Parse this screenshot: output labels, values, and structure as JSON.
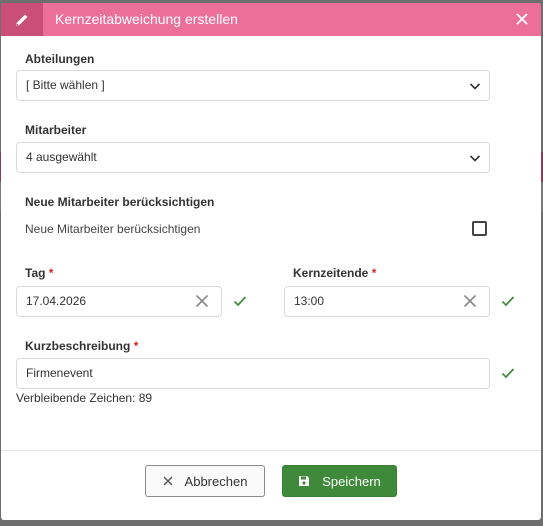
{
  "dialog": {
    "title": "Kernzeitabweichung erstellen",
    "header_icon": "pencil-icon",
    "close_icon": "close-icon"
  },
  "form": {
    "departments": {
      "label": "Abteilungen",
      "value": "[ Bitte wählen ]"
    },
    "employees": {
      "label": "Mitarbeiter",
      "value": "4 ausgewählt"
    },
    "new_employees": {
      "section_label": "Neue Mitarbeiter berücksichtigen",
      "checkbox_label": "Neue Mitarbeiter berücksichtigen",
      "checked": false
    },
    "day": {
      "label": "Tag",
      "required_mark": "*",
      "value": "17.04.2026"
    },
    "core_end": {
      "label": "Kernzeitende",
      "required_mark": "*",
      "value": "13:00"
    },
    "short_desc": {
      "label": "Kurzbeschreibung",
      "required_mark": "*",
      "value": "Firmenevent"
    },
    "remaining": "Verbleibende Zeichen: 89"
  },
  "footer": {
    "cancel_label": "Abbrechen",
    "save_label": "Speichern"
  },
  "colors": {
    "header": "#ec6f99",
    "header_icon_bg": "#c94f78",
    "save_button": "#3f8a3a",
    "valid_check": "#3f8a3a",
    "required": "#c62828"
  }
}
